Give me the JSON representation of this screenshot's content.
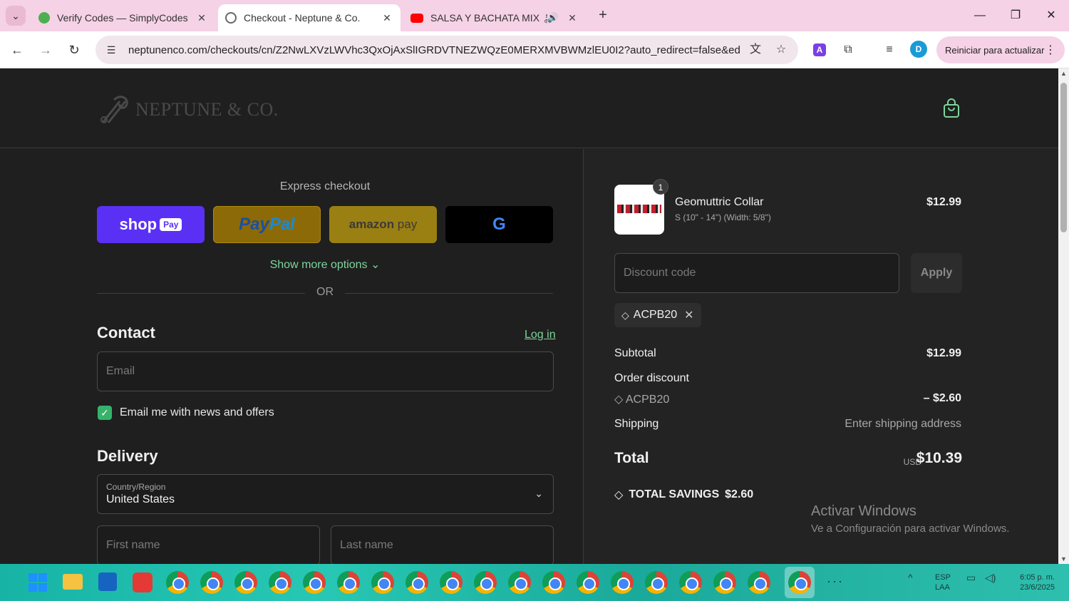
{
  "browser": {
    "tabs": [
      {
        "label": "Verify Codes — SimplyCodes",
        "active": false,
        "favicon_color": "#4caf50"
      },
      {
        "label": "Checkout - Neptune & Co.",
        "active": true,
        "favicon_color": "#666666"
      },
      {
        "label": "SALSA Y BACHATA MIX 🏝",
        "active": false,
        "favicon_color": "#ff0000"
      }
    ],
    "url": "neptunenco.com/checkouts/cn/Z2NwLXVzLWVhc3QxOjAxSlIGRDVTNEZWQzE0MERXMVBWMzlEU0I2?auto_redirect=false&ed...",
    "update_button": "Reiniciar para actualizar",
    "profile_initial": "D"
  },
  "header": {
    "logo_text": "NEPTUNE & CO."
  },
  "express": {
    "title": "Express checkout",
    "shop_word": "shop",
    "shop_pay": "Pay",
    "paypal_a": "Pay",
    "paypal_b": "Pal",
    "amazon_a": "amazon",
    "amazon_b": " pay",
    "google_letter": "G",
    "more_options": "Show more options ⌄",
    "or": "OR"
  },
  "contact": {
    "title": "Contact",
    "login": "Log in",
    "email_placeholder": "Email",
    "newsletter_label": "Email me with news and offers",
    "newsletter_checked": true
  },
  "delivery": {
    "title": "Delivery",
    "country_label": "Country/Region",
    "country_value": "United States",
    "first_name_placeholder": "First name",
    "last_name_placeholder": "Last name"
  },
  "order": {
    "item": {
      "quantity": "1",
      "name": "Geomuttric Collar",
      "variant": "S (10\" - 14\") (Width: 5/8\")",
      "price": "$12.99"
    },
    "discount_placeholder": "Discount code",
    "apply_label": "Apply",
    "applied_code": "ACPB20",
    "subtotal_label": "Subtotal",
    "subtotal_value": "$12.99",
    "order_discount_label": "Order discount",
    "discount_code": "ACPB20",
    "discount_value": "– $2.60",
    "shipping_label": "Shipping",
    "shipping_value": "Enter shipping address",
    "total_label": "Total",
    "total_currency": "USD",
    "total_value": "$10.39",
    "savings_label": "TOTAL SAVINGS",
    "savings_value": "$2.60"
  },
  "watermark": {
    "title": "Activar Windows",
    "subtitle": "Ve a Configuración para activar Windows."
  },
  "taskbar": {
    "lang_top": "ESP",
    "lang_bottom": "LAA",
    "time": "6:05 p. m.",
    "date": "23/6/2025"
  },
  "colors": {
    "accent_green": "#7dd59c",
    "checkbox_green": "#35b36a",
    "shop_purple": "#5a31f4",
    "tab_strip_pink": "#f5d2e6"
  }
}
